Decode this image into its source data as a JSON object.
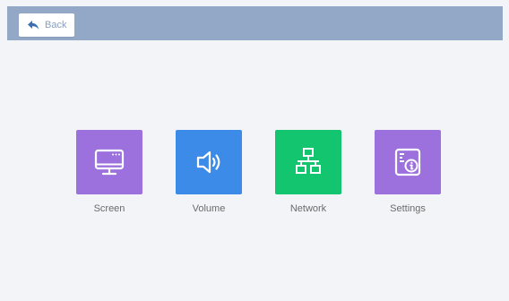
{
  "header": {
    "back_label": "Back"
  },
  "tiles": [
    {
      "label": "Screen",
      "icon": "monitor-icon",
      "color": "#9c71dd"
    },
    {
      "label": "Volume",
      "icon": "speaker-icon",
      "color": "#3c8be8"
    },
    {
      "label": "Network",
      "icon": "network-icon",
      "color": "#13c56e"
    },
    {
      "label": "Settings",
      "icon": "settings-info-icon",
      "color": "#9c71dd"
    }
  ],
  "colors": {
    "topbar": "#93a8c7",
    "background": "#f2f4f7",
    "back_text": "#8aa0c0"
  }
}
